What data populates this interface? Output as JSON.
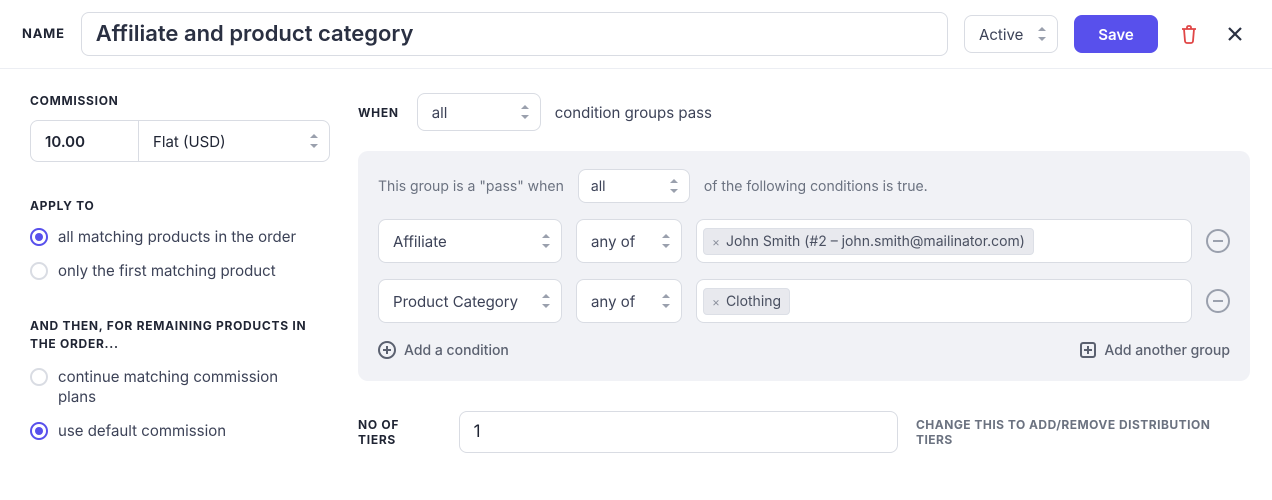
{
  "header": {
    "name_label": "NAME",
    "name_value": "Affiliate and product category",
    "status_value": "Active",
    "save_label": "Save"
  },
  "left": {
    "commission_label": "COMMISSION",
    "commission_value": "10.00",
    "commission_type": "Flat (USD)",
    "apply_to_label": "APPLY TO",
    "apply_options": [
      {
        "label": "all matching products in the order",
        "selected": true
      },
      {
        "label": "only the first matching product",
        "selected": false
      }
    ],
    "remaining_label": "AND THEN, FOR REMAINING PRODUCTS IN THE ORDER...",
    "remaining_options": [
      {
        "label": "continue matching commission plans",
        "selected": false
      },
      {
        "label": "use default commission",
        "selected": true
      }
    ]
  },
  "right": {
    "when_label": "WHEN",
    "when_value": "all",
    "when_suffix": "condition groups pass",
    "group": {
      "desc_prefix": "This group is a \"pass\" when",
      "desc_value": "all",
      "desc_suffix": "of the following conditions is true.",
      "conditions": [
        {
          "field": "Affiliate",
          "op": "any of",
          "chips": [
            "John Smith (#2 – john.smith@mailinator.com)"
          ]
        },
        {
          "field": "Product Category",
          "op": "any of",
          "chips": [
            "Clothing"
          ]
        }
      ],
      "add_condition": "Add a condition",
      "add_group": "Add another group"
    },
    "tiers_label": "NO OF TIERS",
    "tiers_value": "1",
    "tiers_hint": "CHANGE THIS TO ADD/REMOVE DISTRIBUTION TIERS"
  }
}
